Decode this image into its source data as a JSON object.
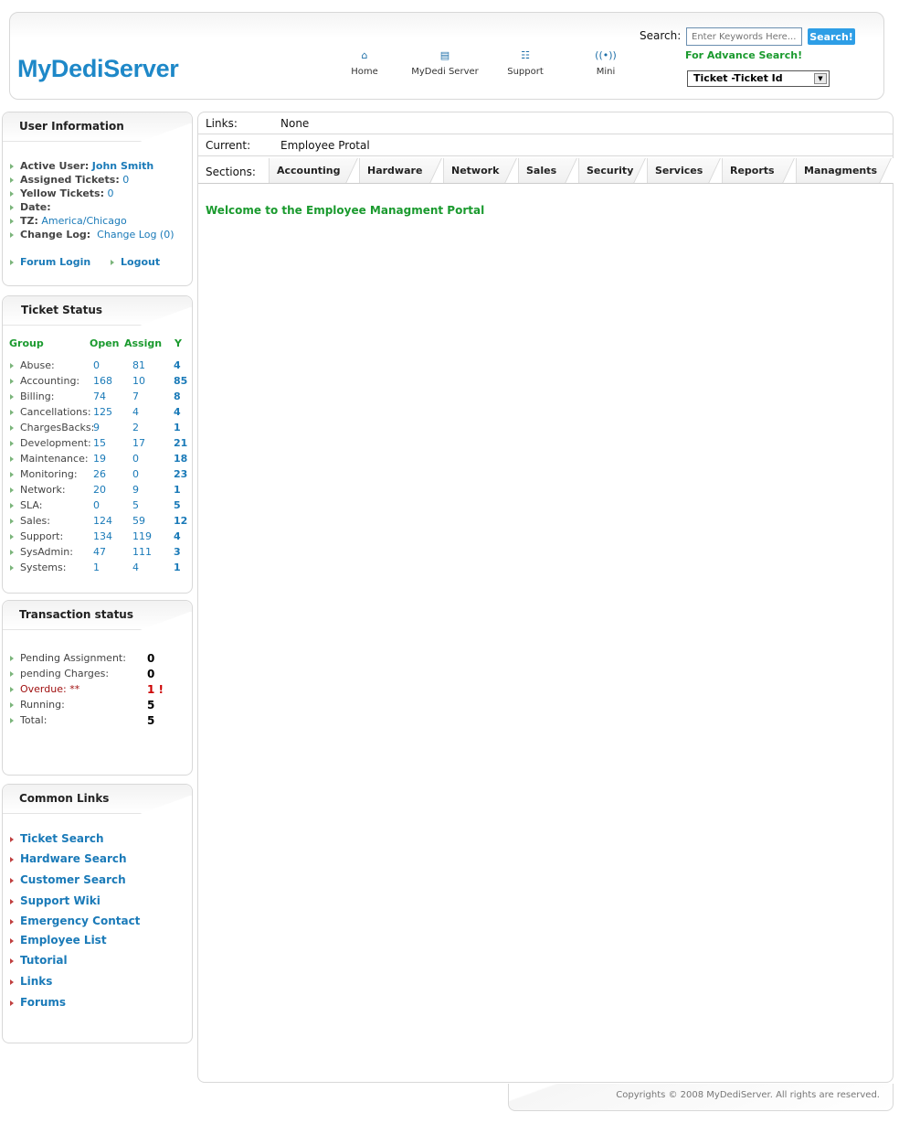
{
  "header": {
    "logo": "MyDediServer",
    "nav": [
      {
        "icon": "home-icon",
        "label": "Home"
      },
      {
        "icon": "server-icon",
        "label": "MyDedi Server"
      },
      {
        "icon": "support-icon",
        "label": "Support"
      },
      {
        "icon": "mini-icon",
        "label": "Mini"
      }
    ],
    "search_label": "Search:",
    "search_placeholder": "Enter Keywords Here....",
    "search_button": "Search!",
    "advance_search": "For Advance Search!",
    "ticket_select": "Ticket -Ticket Id"
  },
  "user_info": {
    "title": "User Information",
    "active_user_label": "Active User:",
    "active_user": "John Smith",
    "assigned_label": "Assigned Tickets:",
    "assigned": "0",
    "yellow_label": "Yellow Tickets:",
    "yellow": "0",
    "date_label": "Date:",
    "tz_label": "TZ:",
    "tz": "America/Chicago",
    "changelog_label": "Change Log:",
    "changelog": "Change Log (0)",
    "forum_login": "Forum Login",
    "logout": "Logout"
  },
  "ticket_status": {
    "title": "Ticket Status",
    "headers": [
      "Group",
      "Open",
      "Assign",
      "Y"
    ],
    "rows": [
      {
        "group": "Abuse:",
        "open": "0",
        "assign": "81",
        "y": "4"
      },
      {
        "group": "Accounting:",
        "open": "168",
        "assign": "10",
        "y": "85"
      },
      {
        "group": "Billing:",
        "open": "74",
        "assign": "7",
        "y": "8"
      },
      {
        "group": "Cancellations:",
        "open": "125",
        "assign": "4",
        "y": "4"
      },
      {
        "group": "ChargesBacks:",
        "open": "9",
        "assign": "2",
        "y": "1"
      },
      {
        "group": "Development:",
        "open": "15",
        "assign": "17",
        "y": "21"
      },
      {
        "group": "Maintenance:",
        "open": "19",
        "assign": "0",
        "y": "18"
      },
      {
        "group": "Monitoring:",
        "open": "26",
        "assign": "0",
        "y": "23"
      },
      {
        "group": "Network:",
        "open": "20",
        "assign": "9",
        "y": "1"
      },
      {
        "group": "SLA:",
        "open": "0",
        "assign": "5",
        "y": "5"
      },
      {
        "group": "Sales:",
        "open": "124",
        "assign": "59",
        "y": "12"
      },
      {
        "group": "Support:",
        "open": "134",
        "assign": "119",
        "y": "4"
      },
      {
        "group": "SysAdmin:",
        "open": "47",
        "assign": "111",
        "y": "3"
      },
      {
        "group": "Systems:",
        "open": "1",
        "assign": "4",
        "y": "1"
      }
    ]
  },
  "transaction_status": {
    "title": "Transaction status",
    "rows": [
      {
        "label": "Pending Assignment:",
        "value": "0"
      },
      {
        "label": "pending Charges:",
        "value": "0"
      },
      {
        "label": "Overdue: **",
        "value": "1  !"
      },
      {
        "label": "Running:",
        "value": "5"
      },
      {
        "label": "Total:",
        "value": "5"
      }
    ]
  },
  "common_links": {
    "title": "Common Links",
    "items": [
      "Ticket Search",
      "Hardware Search",
      "Customer Search",
      "Support Wiki",
      "Emergency Contact",
      "Employee List",
      "Tutorial",
      "Links",
      "Forums"
    ]
  },
  "main": {
    "links_label": "Links:",
    "links_value": "None",
    "current_label": "Current:",
    "current_value": "Employee Protal",
    "sections_label": "Sections:",
    "tabs": [
      "Accounting",
      "Hardware",
      "Network",
      "Sales",
      "Security",
      "Services",
      "Reports",
      "Managments"
    ],
    "welcome": "Welcome to the Employee Managment Portal"
  },
  "footer": {
    "copyright": "Copyrights © 2008 MyDediServer. All rights are reserved."
  }
}
